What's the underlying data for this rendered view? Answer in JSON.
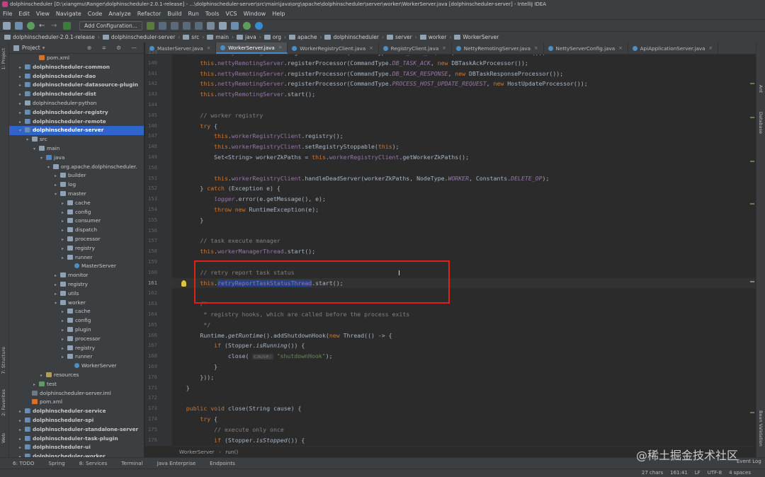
{
  "window": {
    "title": "dolphinscheduler [D:\\xiangmu\\Ranger\\dolphinscheduler-2.0.1-release] - ...\\dolphinscheduler-server\\src\\main\\java\\org\\apache\\dolphinscheduler\\server\\worker\\WorkerServer.java [dolphinscheduler-server] - IntelliJ IDEA"
  },
  "menu": [
    "File",
    "Edit",
    "View",
    "Navigate",
    "Code",
    "Analyze",
    "Refactor",
    "Build",
    "Run",
    "Tools",
    "VCS",
    "Window",
    "Help"
  ],
  "toolbar": {
    "config_label": "Add Configuration..."
  },
  "breadcrumbs": [
    "dolphinscheduler-2.0.1-release",
    "dolphinscheduler-server",
    "src",
    "main",
    "java",
    "org",
    "apache",
    "dolphinscheduler",
    "server",
    "worker",
    "WorkerServer"
  ],
  "side_tabs": {
    "left": [
      "1: Project",
      "7: Structure",
      "2: Favorites",
      "Web"
    ],
    "right": [
      "Ant",
      "Database",
      "Bean Validation"
    ]
  },
  "project": {
    "header": "Project",
    "header_icons": "⊕ ≑ ⚙ —",
    "tree": [
      {
        "label": "pom.xml",
        "indent": 3,
        "icon": "xml",
        "bold": false
      },
      {
        "label": "dolphinscheduler-common",
        "indent": 1,
        "icon": "module",
        "bold": true,
        "arrow": "▸"
      },
      {
        "label": "dolphinscheduler-dao",
        "indent": 1,
        "icon": "module",
        "bold": true,
        "arrow": "▸"
      },
      {
        "label": "dolphinscheduler-datasource-plugin",
        "indent": 1,
        "icon": "module",
        "bold": true,
        "arrow": "▸"
      },
      {
        "label": "dolphinscheduler-dist",
        "indent": 1,
        "icon": "module",
        "bold": true,
        "arrow": "▸"
      },
      {
        "label": "dolphinscheduler-python",
        "indent": 1,
        "icon": "folder",
        "bold": false,
        "arrow": "▸"
      },
      {
        "label": "dolphinscheduler-registry",
        "indent": 1,
        "icon": "module",
        "bold": true,
        "arrow": "▸"
      },
      {
        "label": "dolphinscheduler-remote",
        "indent": 1,
        "icon": "module",
        "bold": true,
        "arrow": "▸"
      },
      {
        "label": "dolphinscheduler-server",
        "indent": 1,
        "icon": "module",
        "bold": true,
        "arrow": "▾",
        "selected": true
      },
      {
        "label": "src",
        "indent": 2,
        "icon": "folder",
        "bold": false,
        "arrow": "▾"
      },
      {
        "label": "main",
        "indent": 3,
        "icon": "folder",
        "bold": false,
        "arrow": "▾"
      },
      {
        "label": "java",
        "indent": 4,
        "icon": "src",
        "bold": false,
        "arrow": "▾"
      },
      {
        "label": "org.apache.dolphinscheduler.",
        "indent": 5,
        "icon": "pkg",
        "bold": false,
        "arrow": "▾"
      },
      {
        "label": "builder",
        "indent": 6,
        "icon": "pkg",
        "bold": false,
        "arrow": "▸"
      },
      {
        "label": "log",
        "indent": 6,
        "icon": "pkg",
        "bold": false,
        "arrow": "▸"
      },
      {
        "label": "master",
        "indent": 6,
        "icon": "pkg",
        "bold": false,
        "arrow": "▾"
      },
      {
        "label": "cache",
        "indent": 7,
        "icon": "pkg",
        "bold": false,
        "arrow": "▸"
      },
      {
        "label": "config",
        "indent": 7,
        "icon": "pkg",
        "bold": false,
        "arrow": "▸"
      },
      {
        "label": "consumer",
        "indent": 7,
        "icon": "pkg",
        "bold": false,
        "arrow": "▸"
      },
      {
        "label": "dispatch",
        "indent": 7,
        "icon": "pkg",
        "bold": false,
        "arrow": "▸"
      },
      {
        "label": "processor",
        "indent": 7,
        "icon": "pkg",
        "bold": false,
        "arrow": "▸"
      },
      {
        "label": "registry",
        "indent": 7,
        "icon": "pkg",
        "bold": false,
        "arrow": "▸"
      },
      {
        "label": "runner",
        "indent": 7,
        "icon": "pkg",
        "bold": false,
        "arrow": "▸"
      },
      {
        "label": "MasterServer",
        "indent": 8,
        "icon": "class",
        "bold": false
      },
      {
        "label": "monitor",
        "indent": 6,
        "icon": "pkg",
        "bold": false,
        "arrow": "▸"
      },
      {
        "label": "registry",
        "indent": 6,
        "icon": "pkg",
        "bold": false,
        "arrow": "▸"
      },
      {
        "label": "utils",
        "indent": 6,
        "icon": "pkg",
        "bold": false,
        "arrow": "▸"
      },
      {
        "label": "worker",
        "indent": 6,
        "icon": "pkg",
        "bold": false,
        "arrow": "▾"
      },
      {
        "label": "cache",
        "indent": 7,
        "icon": "pkg",
        "bold": false,
        "arrow": "▸"
      },
      {
        "label": "config",
        "indent": 7,
        "icon": "pkg",
        "bold": false,
        "arrow": "▸"
      },
      {
        "label": "plugin",
        "indent": 7,
        "icon": "pkg",
        "bold": false,
        "arrow": "▸"
      },
      {
        "label": "processor",
        "indent": 7,
        "icon": "pkg",
        "bold": false,
        "arrow": "▸"
      },
      {
        "label": "registry",
        "indent": 7,
        "icon": "pkg",
        "bold": false,
        "arrow": "▸"
      },
      {
        "label": "runner",
        "indent": 7,
        "icon": "pkg",
        "bold": false,
        "arrow": "▸"
      },
      {
        "label": "WorkerServer",
        "indent": 8,
        "icon": "class",
        "bold": false
      },
      {
        "label": "resources",
        "indent": 4,
        "icon": "res",
        "bold": false,
        "arrow": "▸"
      },
      {
        "label": "test",
        "indent": 3,
        "icon": "test",
        "bold": false,
        "arrow": "▸"
      },
      {
        "label": "dolphinscheduler-server.iml",
        "indent": 2,
        "icon": "iml",
        "bold": false
      },
      {
        "label": "pom.xml",
        "indent": 2,
        "icon": "xml",
        "bold": false
      },
      {
        "label": "dolphinscheduler-service",
        "indent": 1,
        "icon": "module",
        "bold": true,
        "arrow": "▸"
      },
      {
        "label": "dolphinscheduler-spi",
        "indent": 1,
        "icon": "module",
        "bold": true,
        "arrow": "▸"
      },
      {
        "label": "dolphinscheduler-standalone-server",
        "indent": 1,
        "icon": "module",
        "bold": true,
        "arrow": "▸"
      },
      {
        "label": "dolphinscheduler-task-plugin",
        "indent": 1,
        "icon": "module",
        "bold": true,
        "arrow": "▸"
      },
      {
        "label": "dolphinscheduler-ui",
        "indent": 1,
        "icon": "module",
        "bold": true,
        "arrow": "▸"
      },
      {
        "label": "dolphinscheduler-worker",
        "indent": 1,
        "icon": "module",
        "bold": true,
        "arrow": "▸"
      }
    ]
  },
  "tabs": [
    {
      "label": "MasterServer.java",
      "active": false
    },
    {
      "label": "WorkerServer.java",
      "active": true
    },
    {
      "label": "WorkerRegistryClient.java",
      "active": false
    },
    {
      "label": "RegistryClient.java",
      "active": false
    },
    {
      "label": "NettyRemotingServer.java",
      "active": false
    },
    {
      "label": "NettyServerConfig.java",
      "active": false
    },
    {
      "label": "ApiApplicationServer.java",
      "active": false
    }
  ],
  "editor": {
    "current_line": 161,
    "code": [
      {
        "n": 139,
        "html": "        <span class=\"kw\">this</span>.<span class=\"fld\">nettyRemotingServer</span>.registerProcessor(CommandType.<span class=\"cst\">TASK_KILL_REQUEST</span>, <span class=\"kw\">new</span> TaskKillProcessor());"
      },
      {
        "n": 140,
        "html": "        <span class=\"kw\">this</span>.<span class=\"fld\">nettyRemotingServer</span>.registerProcessor(CommandType.<span class=\"cst\">DB_TASK_ACK</span>, <span class=\"kw\">new</span> DBTaskAckProcessor());"
      },
      {
        "n": 141,
        "html": "        <span class=\"kw\">this</span>.<span class=\"fld\">nettyRemotingServer</span>.registerProcessor(CommandType.<span class=\"cst\">DB_TASK_RESPONSE</span>, <span class=\"kw\">new</span> DBTaskResponseProcessor());"
      },
      {
        "n": 142,
        "html": "        <span class=\"kw\">this</span>.<span class=\"fld\">nettyRemotingServer</span>.registerProcessor(CommandType.<span class=\"cst\">PROCESS_HOST_UPDATE_REQUEST</span>, <span class=\"kw\">new</span> HostUpdateProcessor());"
      },
      {
        "n": 143,
        "html": "        <span class=\"kw\">this</span>.<span class=\"fld\">nettyRemotingServer</span>.start();"
      },
      {
        "n": 144,
        "html": ""
      },
      {
        "n": 145,
        "html": "        <span class=\"cmt\">// worker registry</span>"
      },
      {
        "n": 146,
        "html": "        <span class=\"kw\">try</span> {"
      },
      {
        "n": 147,
        "html": "            <span class=\"kw\">this</span>.<span class=\"fld\">workerRegistryClient</span>.registry();"
      },
      {
        "n": 148,
        "html": "            <span class=\"kw\">this</span>.<span class=\"fld\">workerRegistryClient</span>.setRegistryStoppable(<span class=\"kw\">this</span>);"
      },
      {
        "n": 149,
        "html": "            Set&lt;String&gt; workerZkPaths = <span class=\"kw\">this</span>.<span class=\"fld\">workerRegistryClient</span>.getWorkerZkPaths();"
      },
      {
        "n": 150,
        "html": ""
      },
      {
        "n": 151,
        "html": "            <span class=\"kw\">this</span>.<span class=\"fld\">workerRegistryClient</span>.handleDeadServer(workerZkPaths, NodeType.<span class=\"cst\">WORKER</span>, Constants.<span class=\"cst\">DELETE_OP</span>);"
      },
      {
        "n": 152,
        "html": "        } <span class=\"kw\">catch</span> (Exception e) {"
      },
      {
        "n": 153,
        "html": "            <span class=\"cst\">logger</span>.error(e.getMessage(), e);"
      },
      {
        "n": 154,
        "html": "            <span class=\"kw\">throw new</span> RuntimeException(e);"
      },
      {
        "n": 155,
        "html": "        }"
      },
      {
        "n": 156,
        "html": ""
      },
      {
        "n": 157,
        "html": "        <span class=\"cmt\">// task execute manager</span>"
      },
      {
        "n": 158,
        "html": "        <span class=\"kw\">this</span>.<span class=\"fld\">workerManagerThread</span>.start();"
      },
      {
        "n": 159,
        "html": ""
      },
      {
        "n": 160,
        "html": "        <span class=\"cmt\">// retry report task status</span>"
      },
      {
        "n": 161,
        "html": "        <span class=\"kw\">this</span>.<span class=\"fld sel\">retryReportTaskStatusThread</span>.start();"
      },
      {
        "n": 162,
        "html": ""
      },
      {
        "n": 163,
        "html": "        <span class=\"cmt\">/*</span>"
      },
      {
        "n": 164,
        "html": "<span class=\"cmt\">         * registry hooks, which are called before the process exits</span>"
      },
      {
        "n": 165,
        "html": "<span class=\"cmt\">         */</span>"
      },
      {
        "n": 166,
        "html": "        Runtime.<span class=\"stat\">getRuntime</span>().addShutdownHook(<span class=\"kw\">new</span> Thread(() -&gt; {"
      },
      {
        "n": 167,
        "html": "            <span class=\"kw\">if</span> (Stopper.<span class=\"stat\">isRunning</span>()) {"
      },
      {
        "n": 168,
        "html": "                close( <span class=\"hint\">cause:</span> <span class=\"str\">\"shutdownHook\"</span>);"
      },
      {
        "n": 169,
        "html": "            }"
      },
      {
        "n": 170,
        "html": "        }));"
      },
      {
        "n": 171,
        "html": "    }"
      },
      {
        "n": 172,
        "html": ""
      },
      {
        "n": 173,
        "html": "    <span class=\"kw\">public void</span> close(String cause) {"
      },
      {
        "n": 174,
        "html": "        <span class=\"kw\">try</span> {"
      },
      {
        "n": 175,
        "html": "            <span class=\"cmt\">// execute only once</span>"
      },
      {
        "n": 176,
        "html": "            <span class=\"kw\">if</span> (Stopper.<span class=\"stat\">isStopped</span>()) {"
      }
    ],
    "breadcrumb": [
      "WorkerServer",
      "run()"
    ]
  },
  "toolwindows": [
    "6: TODO",
    "Spring",
    "8: Services",
    "Terminal",
    "Java Enterprise",
    "Endpoints"
  ],
  "event_log": "Event Log",
  "status": {
    "chars": "27 chars",
    "position": "161:41",
    "line_sep": "LF",
    "encoding": "UTF-8",
    "indent": "4 spaces"
  },
  "watermark": "@稀土掘金技术社区",
  "colors": {
    "highlight_box": "#e0201a",
    "selection": "#214283",
    "keyword": "#cc7832",
    "field": "#9876aa",
    "comment": "#808080",
    "string": "#6a8759"
  }
}
